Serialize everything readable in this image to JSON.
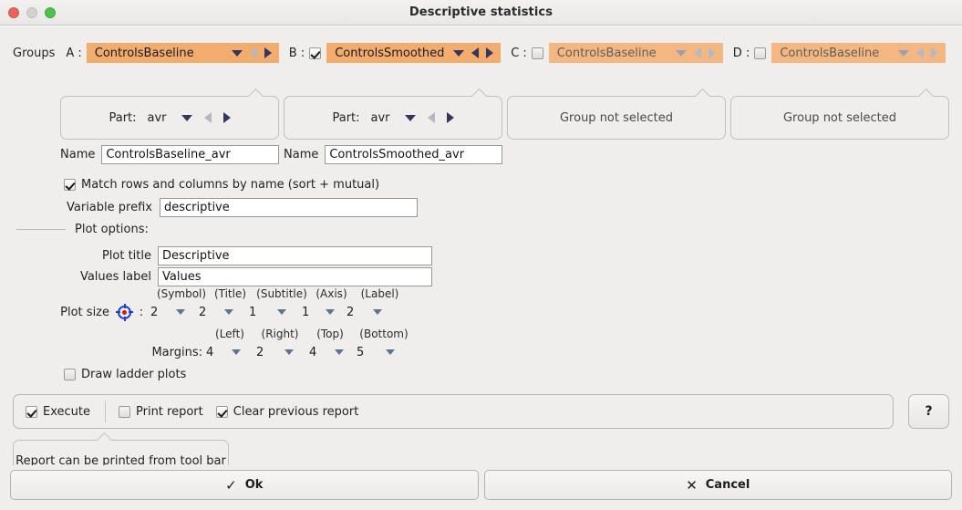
{
  "window": {
    "title": "Descriptive statistics",
    "traffic_lights": [
      "close-button",
      "minimize-button",
      "maximize-button"
    ]
  },
  "groups": {
    "label": "Groups",
    "items": [
      {
        "letter": "A :",
        "has_checkbox": false,
        "checked": true,
        "enabled": true,
        "value": "ControlsBaseline",
        "prev_enabled": false,
        "next_enabled": true,
        "part_label": "Part:",
        "part_value": "avr",
        "part_prev_enabled": false,
        "part_next_enabled": true,
        "name_label": "Name",
        "name_value": "ControlsBaseline_avr",
        "not_selected_text": ""
      },
      {
        "letter": "B :",
        "has_checkbox": true,
        "checked": true,
        "enabled": true,
        "value": "ControlsSmoothed",
        "prev_enabled": true,
        "next_enabled": true,
        "part_label": "Part:",
        "part_value": "avr",
        "part_prev_enabled": false,
        "part_next_enabled": true,
        "name_label": "Name",
        "name_value": "ControlsSmoothed_avr",
        "not_selected_text": ""
      },
      {
        "letter": "C :",
        "has_checkbox": true,
        "checked": false,
        "enabled": false,
        "value": "ControlsBaseline",
        "prev_enabled": false,
        "next_enabled": false,
        "part_label": "",
        "part_value": "",
        "name_label": "",
        "name_value": "",
        "not_selected_text": "Group not selected"
      },
      {
        "letter": "D :",
        "has_checkbox": true,
        "checked": false,
        "enabled": false,
        "value": "ControlsBaseline",
        "prev_enabled": false,
        "next_enabled": false,
        "part_label": "",
        "part_value": "",
        "name_label": "",
        "name_value": "",
        "not_selected_text": "Group not selected"
      }
    ]
  },
  "match": {
    "label": "Match rows and columns by name (sort + mutual)",
    "checked": true
  },
  "prefix": {
    "label": "Variable prefix",
    "value": "descriptive"
  },
  "plot_options": {
    "section_label": "Plot options:",
    "plot_title_label": "Plot title",
    "plot_title_value": "Descriptive",
    "values_label_label": "Values label",
    "values_label_value": "Values",
    "plot_size_label": "Plot size",
    "plot_size_colon": ":",
    "size_captions": [
      "(Symbol)",
      "(Title)",
      "(Subtitle)",
      "(Axis)",
      "(Label)"
    ],
    "size_values": [
      "2",
      "2",
      "1",
      "1",
      "2"
    ],
    "margins_label": "Margins:",
    "margin_captions": [
      "(Left)",
      "(Right)",
      "(Top)",
      "(Bottom)"
    ],
    "margin_values": [
      "4",
      "2",
      "4",
      "5"
    ]
  },
  "ladder": {
    "label": "Draw ladder plots",
    "checked": false
  },
  "exec_bar": {
    "execute_label": "Execute",
    "execute_checked": true,
    "print_label": "Print report",
    "print_checked": false,
    "clear_label": "Clear previous report",
    "clear_checked": true,
    "help_label": "?"
  },
  "note": {
    "text": "Report can be printed from tool bar"
  },
  "footer": {
    "ok_label": "Ok",
    "ok_glyph": "✓",
    "cancel_label": "Cancel",
    "cancel_glyph": "✕"
  },
  "colors": {
    "combo_accent": "#f2ac6e",
    "combo_accent_disabled": "#f5b781",
    "window_bg": "#efeeed",
    "arrow_navy": "#33375e",
    "target_blue": "#1a3fd4",
    "target_red": "#d01818"
  }
}
